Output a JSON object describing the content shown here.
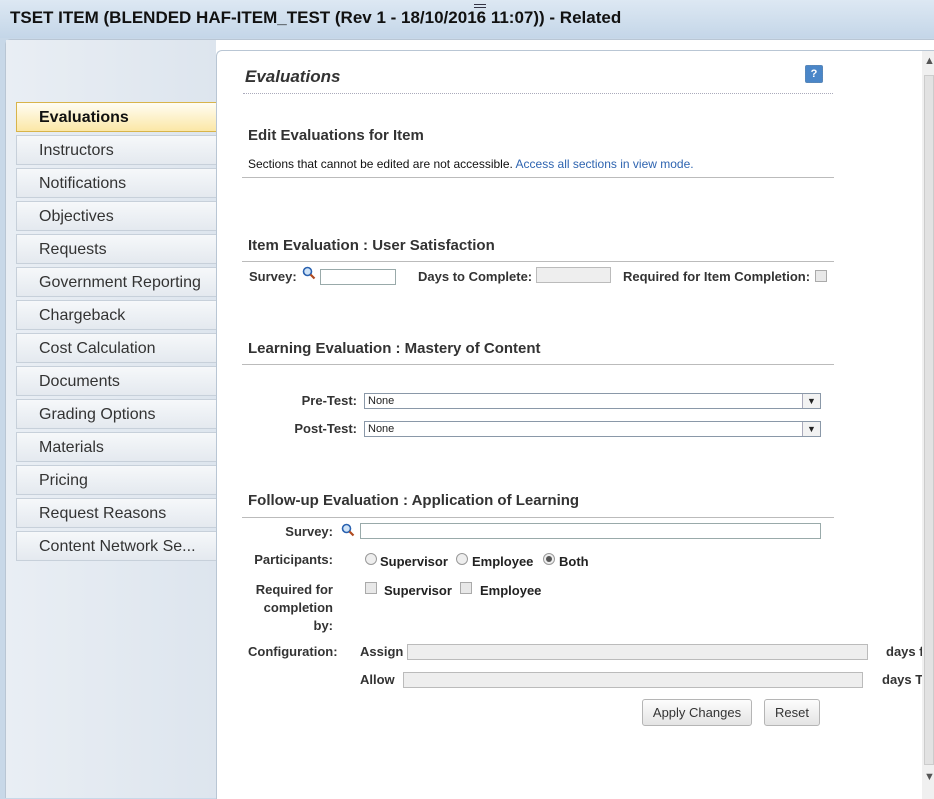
{
  "window": {
    "title": "TSET ITEM (BLENDED HAF-ITEM_TEST (Rev 1 - 18/10/2016 11:07)) - Related"
  },
  "nav": {
    "items": [
      {
        "label": "Evaluations"
      },
      {
        "label": "Instructors"
      },
      {
        "label": "Notifications"
      },
      {
        "label": "Objectives"
      },
      {
        "label": "Requests"
      },
      {
        "label": "Government Reporting"
      },
      {
        "label": "Chargeback"
      },
      {
        "label": "Cost Calculation"
      },
      {
        "label": "Documents"
      },
      {
        "label": "Grading Options"
      },
      {
        "label": "Materials"
      },
      {
        "label": "Pricing"
      },
      {
        "label": "Request Reasons"
      },
      {
        "label": "Content Network Se..."
      }
    ],
    "active_index": 0
  },
  "page": {
    "title": "Evaluations",
    "help_icon": "help-icon",
    "edit_title": "Edit Evaluations for Item",
    "edit_note": "Sections that cannot be edited are not accessible.",
    "edit_link": "Access all sections in view mode."
  },
  "item_eval": {
    "title": "Item Evaluation : User Satisfaction",
    "survey_label": "Survey:",
    "survey_value": "",
    "days_label": "Days to Complete:",
    "days_value": "",
    "required_label": "Required for Item Completion:",
    "required_checked": false
  },
  "learning_eval": {
    "title": "Learning Evaluation : Mastery of Content",
    "pretest_label": "Pre-Test:",
    "pretest_value": "None",
    "posttest_label": "Post-Test:",
    "posttest_value": "None"
  },
  "followup_eval": {
    "title": "Follow-up Evaluation : Application of Learning",
    "survey_label": "Survey:",
    "survey_value": "",
    "participants_label": "Participants:",
    "participants_options": [
      "Supervisor",
      "Employee",
      "Both"
    ],
    "participants_selected": "Both",
    "required_label_1": "Required for",
    "required_label_2": "completion",
    "required_label_3": "by:",
    "required_options": [
      "Supervisor",
      "Employee"
    ],
    "config_label": "Configuration:",
    "assign_label": "Assign",
    "assign_suffix": "days fr",
    "allow_label": "Allow",
    "allow_suffix": "days To"
  },
  "buttons": {
    "apply": "Apply Changes",
    "reset": "Reset"
  }
}
